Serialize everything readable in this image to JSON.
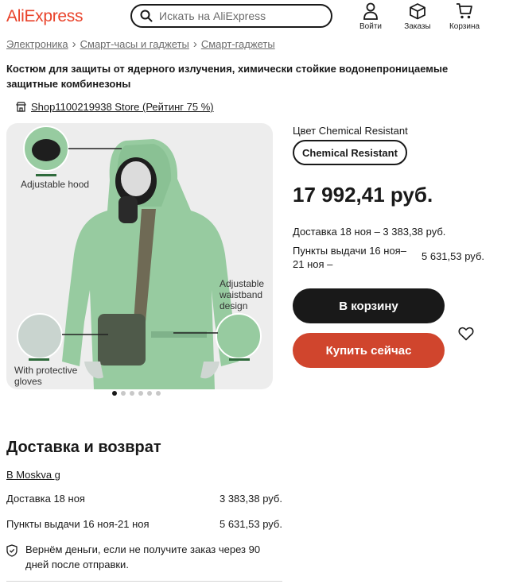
{
  "header": {
    "logo": "AliExpress",
    "search_placeholder": "Искать на AliExpress",
    "nav": [
      {
        "label": "Войти",
        "icon": "user-icon"
      },
      {
        "label": "Заказы",
        "icon": "package-icon"
      },
      {
        "label": "Корзина",
        "icon": "cart-icon"
      }
    ]
  },
  "breadcrumb": [
    "Электроника",
    "Смарт-часы и гаджеты",
    "Смарт-гаджеты"
  ],
  "product": {
    "title": "Костюм для защиты от ядерного излучения, химически стойкие водонепроницаемые защитные комбинезоны",
    "store": "Shop1100219938 Store (Рейтинг 75 %)",
    "gallery": {
      "labels": {
        "hood": "Adjustable hood",
        "waist_line1": "Adjustable",
        "waist_line2": "waistband",
        "waist_line3": "design",
        "gloves_line1": "With protective",
        "gloves_line2": "gloves"
      },
      "image_count": 6,
      "active_index": 0
    },
    "color_label": "Цвет Chemical Resistant",
    "color_option": "Chemical Resistant",
    "price": "17 992,41 руб.",
    "shipping_line": "Доставка 18 ноя – 3 383,38 руб.",
    "pickup_line": "Пункты выдачи 16 ноя–21 ноя",
    "pickup_dash": "–",
    "pickup_price": "5 631,53 руб.",
    "add_to_cart": "В корзину",
    "buy_now": "Купить сейчас"
  },
  "delivery": {
    "title": "Доставка и возврат",
    "city": "В Moskva g",
    "rows": [
      {
        "label": "Доставка 18 ноя",
        "price": "3 383,38 руб."
      },
      {
        "label": "Пункты выдачи 16 ноя-21 ноя",
        "price": "5 631,53 руб."
      }
    ],
    "refund": "Вернём деньги, если не получите заказ через 90 дней после отправки."
  },
  "colors": {
    "brand": "#e9432b",
    "buy_button": "#d0452d",
    "cart_button": "#191919",
    "suit_green": "#97cba0"
  }
}
